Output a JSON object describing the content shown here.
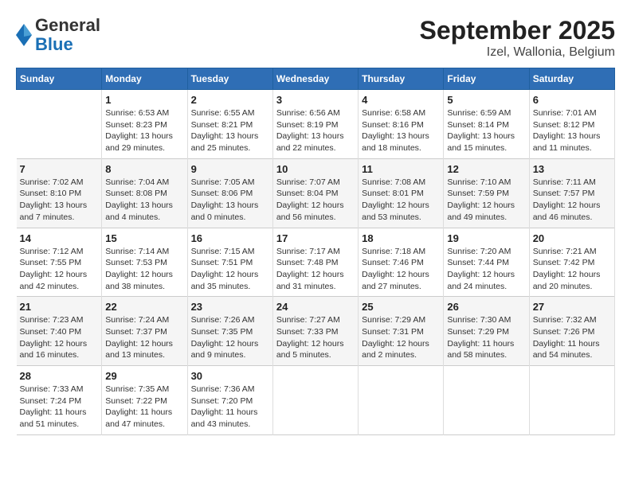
{
  "logo": {
    "general": "General",
    "blue": "Blue"
  },
  "title": "September 2025",
  "subtitle": "Izel, Wallonia, Belgium",
  "weekdays": [
    "Sunday",
    "Monday",
    "Tuesday",
    "Wednesday",
    "Thursday",
    "Friday",
    "Saturday"
  ],
  "weeks": [
    [
      {
        "day": "",
        "info": ""
      },
      {
        "day": "1",
        "info": "Sunrise: 6:53 AM\nSunset: 8:23 PM\nDaylight: 13 hours\nand 29 minutes."
      },
      {
        "day": "2",
        "info": "Sunrise: 6:55 AM\nSunset: 8:21 PM\nDaylight: 13 hours\nand 25 minutes."
      },
      {
        "day": "3",
        "info": "Sunrise: 6:56 AM\nSunset: 8:19 PM\nDaylight: 13 hours\nand 22 minutes."
      },
      {
        "day": "4",
        "info": "Sunrise: 6:58 AM\nSunset: 8:16 PM\nDaylight: 13 hours\nand 18 minutes."
      },
      {
        "day": "5",
        "info": "Sunrise: 6:59 AM\nSunset: 8:14 PM\nDaylight: 13 hours\nand 15 minutes."
      },
      {
        "day": "6",
        "info": "Sunrise: 7:01 AM\nSunset: 8:12 PM\nDaylight: 13 hours\nand 11 minutes."
      }
    ],
    [
      {
        "day": "7",
        "info": "Sunrise: 7:02 AM\nSunset: 8:10 PM\nDaylight: 13 hours\nand 7 minutes."
      },
      {
        "day": "8",
        "info": "Sunrise: 7:04 AM\nSunset: 8:08 PM\nDaylight: 13 hours\nand 4 minutes."
      },
      {
        "day": "9",
        "info": "Sunrise: 7:05 AM\nSunset: 8:06 PM\nDaylight: 13 hours\nand 0 minutes."
      },
      {
        "day": "10",
        "info": "Sunrise: 7:07 AM\nSunset: 8:04 PM\nDaylight: 12 hours\nand 56 minutes."
      },
      {
        "day": "11",
        "info": "Sunrise: 7:08 AM\nSunset: 8:01 PM\nDaylight: 12 hours\nand 53 minutes."
      },
      {
        "day": "12",
        "info": "Sunrise: 7:10 AM\nSunset: 7:59 PM\nDaylight: 12 hours\nand 49 minutes."
      },
      {
        "day": "13",
        "info": "Sunrise: 7:11 AM\nSunset: 7:57 PM\nDaylight: 12 hours\nand 46 minutes."
      }
    ],
    [
      {
        "day": "14",
        "info": "Sunrise: 7:12 AM\nSunset: 7:55 PM\nDaylight: 12 hours\nand 42 minutes."
      },
      {
        "day": "15",
        "info": "Sunrise: 7:14 AM\nSunset: 7:53 PM\nDaylight: 12 hours\nand 38 minutes."
      },
      {
        "day": "16",
        "info": "Sunrise: 7:15 AM\nSunset: 7:51 PM\nDaylight: 12 hours\nand 35 minutes."
      },
      {
        "day": "17",
        "info": "Sunrise: 7:17 AM\nSunset: 7:48 PM\nDaylight: 12 hours\nand 31 minutes."
      },
      {
        "day": "18",
        "info": "Sunrise: 7:18 AM\nSunset: 7:46 PM\nDaylight: 12 hours\nand 27 minutes."
      },
      {
        "day": "19",
        "info": "Sunrise: 7:20 AM\nSunset: 7:44 PM\nDaylight: 12 hours\nand 24 minutes."
      },
      {
        "day": "20",
        "info": "Sunrise: 7:21 AM\nSunset: 7:42 PM\nDaylight: 12 hours\nand 20 minutes."
      }
    ],
    [
      {
        "day": "21",
        "info": "Sunrise: 7:23 AM\nSunset: 7:40 PM\nDaylight: 12 hours\nand 16 minutes."
      },
      {
        "day": "22",
        "info": "Sunrise: 7:24 AM\nSunset: 7:37 PM\nDaylight: 12 hours\nand 13 minutes."
      },
      {
        "day": "23",
        "info": "Sunrise: 7:26 AM\nSunset: 7:35 PM\nDaylight: 12 hours\nand 9 minutes."
      },
      {
        "day": "24",
        "info": "Sunrise: 7:27 AM\nSunset: 7:33 PM\nDaylight: 12 hours\nand 5 minutes."
      },
      {
        "day": "25",
        "info": "Sunrise: 7:29 AM\nSunset: 7:31 PM\nDaylight: 12 hours\nand 2 minutes."
      },
      {
        "day": "26",
        "info": "Sunrise: 7:30 AM\nSunset: 7:29 PM\nDaylight: 11 hours\nand 58 minutes."
      },
      {
        "day": "27",
        "info": "Sunrise: 7:32 AM\nSunset: 7:26 PM\nDaylight: 11 hours\nand 54 minutes."
      }
    ],
    [
      {
        "day": "28",
        "info": "Sunrise: 7:33 AM\nSunset: 7:24 PM\nDaylight: 11 hours\nand 51 minutes."
      },
      {
        "day": "29",
        "info": "Sunrise: 7:35 AM\nSunset: 7:22 PM\nDaylight: 11 hours\nand 47 minutes."
      },
      {
        "day": "30",
        "info": "Sunrise: 7:36 AM\nSunset: 7:20 PM\nDaylight: 11 hours\nand 43 minutes."
      },
      {
        "day": "",
        "info": ""
      },
      {
        "day": "",
        "info": ""
      },
      {
        "day": "",
        "info": ""
      },
      {
        "day": "",
        "info": ""
      }
    ]
  ]
}
